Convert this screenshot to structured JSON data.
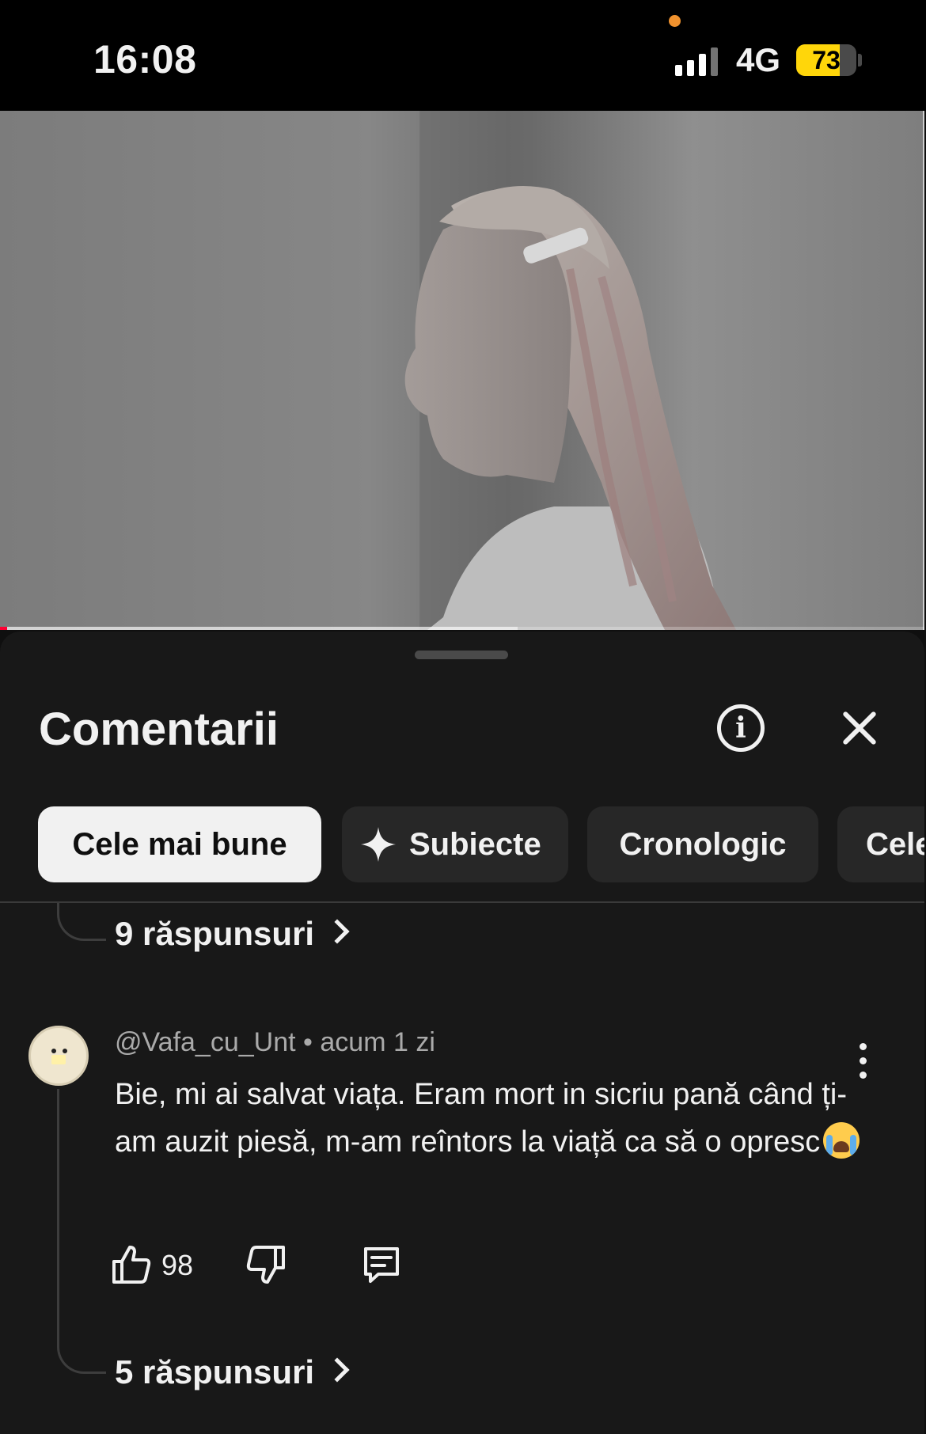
{
  "status_bar": {
    "time": "16:08",
    "network": "4G",
    "battery": "73",
    "battery_level": 0.73,
    "privacy_indicator_color": "#f0922e"
  },
  "video": {
    "playback_progress": 0.008,
    "buffered_progress": 0.56,
    "progress_color": "#ff0033"
  },
  "comments_panel": {
    "title": "Comentarii",
    "info_icon": "info-icon",
    "close_icon": "close-icon",
    "filters": [
      {
        "label": "Cele mai bune",
        "active": true
      },
      {
        "label": "Subiecte",
        "icon": "sparkle-icon",
        "active": false
      },
      {
        "label": "Cronologic",
        "active": false
      },
      {
        "label": "Cele",
        "active": false
      }
    ],
    "previous_thread": {
      "replies_label": "9 răspunsuri"
    },
    "comment": {
      "author": "@Vafa_cu_Unt",
      "separator": "•",
      "time": "acum 1 zi",
      "text": "Bie, mi ai salvat viața. Eram mort in sicriu pană când ți-am auzit piesă, m-am reîntors la viață ca să o opresc",
      "emoji": "loudly-crying-face-emoji",
      "likes": "98",
      "replies_label": "5 răspunsuri"
    }
  }
}
